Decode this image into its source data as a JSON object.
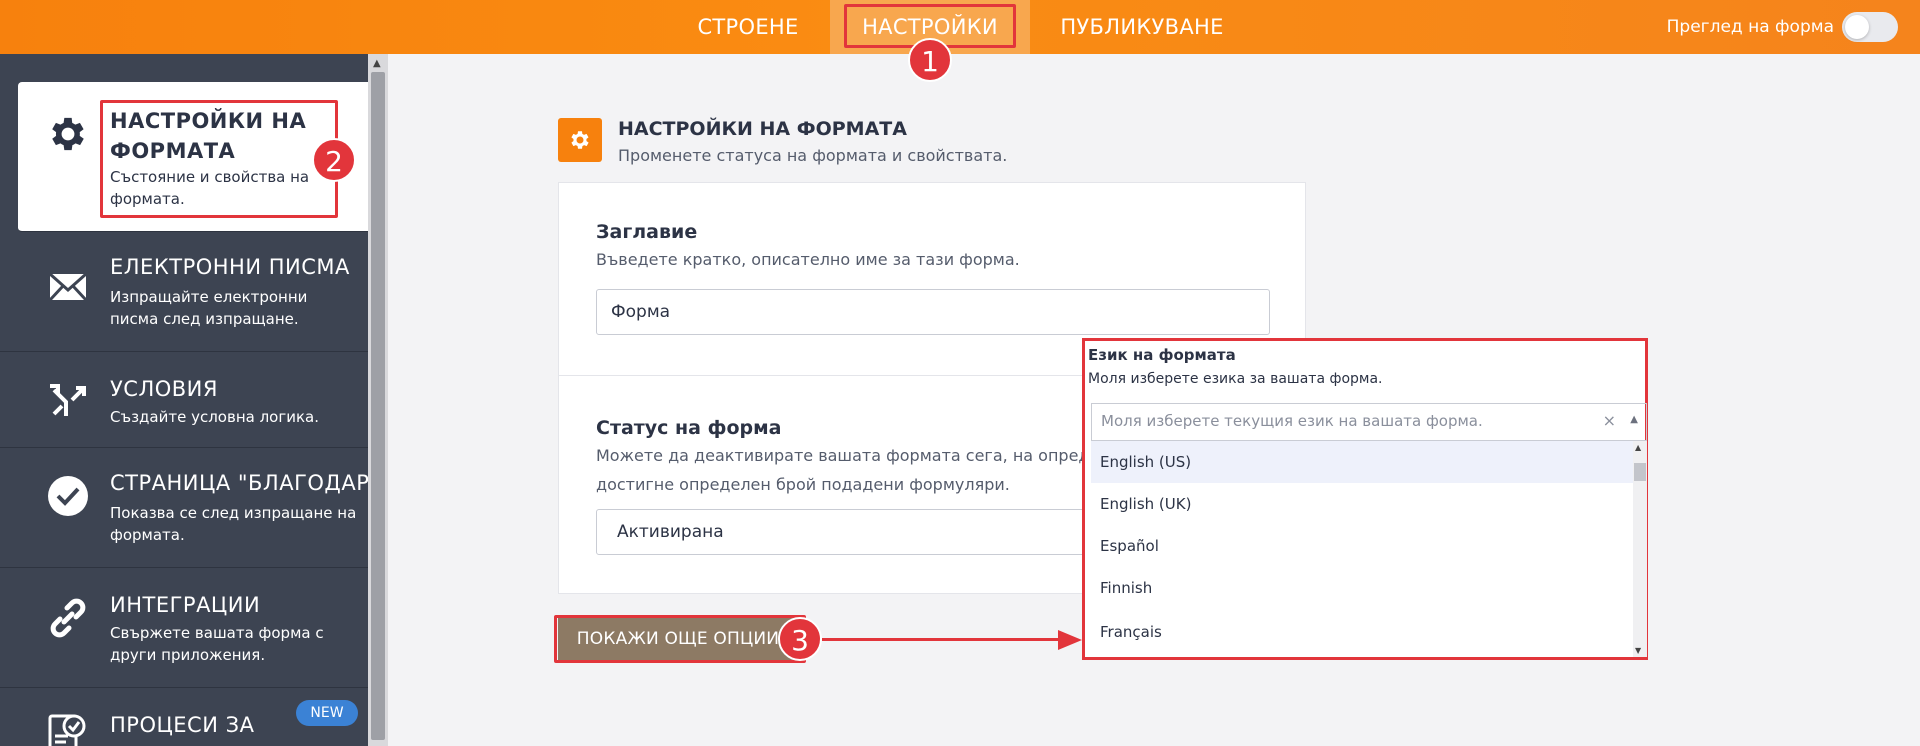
{
  "topbar": {
    "tabs": [
      {
        "label": "СТРОЕНЕ"
      },
      {
        "label": "НАСТРОЙКИ"
      },
      {
        "label": "ПУБЛИКУВАНЕ"
      }
    ],
    "preview_label": "Преглед на форма"
  },
  "sidebar": {
    "items": [
      {
        "title": "НАСТРОЙКИ НА ФОРМАТА",
        "desc": "Състояние и свойства на формата."
      },
      {
        "title": "ЕЛЕКТРОННИ ПИСМА",
        "desc": "Изпращайте електронни писма след изпращане."
      },
      {
        "title": "УСЛОВИЯ",
        "desc": "Създайте условна логика."
      },
      {
        "title": "СТРАНИЦА \"БЛАГОДАРЯ\"",
        "desc": "Показва се след изпращане на формата."
      },
      {
        "title": "ИНТЕГРАЦИИ",
        "desc": "Свържете вашата форма с други приложения."
      },
      {
        "title": "ПРОЦЕСИ ЗА",
        "badge": "NEW"
      }
    ]
  },
  "main": {
    "section_title": "НАСТРОЙКИ НА ФОРМАТА",
    "section_subtitle": "Променете статуса на формата и свойствата.",
    "title_field": {
      "label": "Заглавие",
      "desc": "Въведете кратко, описателно име за тази форма.",
      "value": "Форма"
    },
    "status_field": {
      "label": "Статус на форма",
      "desc_line1": "Можете да деактивирате вашата формата сега, на определе",
      "desc_line2": "достигне определен брой подадени формуляри.",
      "value": "Активирана"
    },
    "more_options_button": "ПОКАЖИ ОЩЕ ОПЦИИ"
  },
  "language_popup": {
    "title": "Език на формата",
    "subtitle": "Моля изберете езика за вашата форма.",
    "search_placeholder": "Моля изберете текущия език на вашата форма.",
    "clear_symbol": "×",
    "options": [
      "English (US)",
      "English (UK)",
      "Español",
      "Finnish",
      "Français"
    ]
  },
  "annotations": {
    "steps": [
      "1",
      "2",
      "3"
    ]
  },
  "colors": {
    "accent": "#f7810d",
    "sidebar_bg": "#3d4452",
    "annotation_red": "#e2353b",
    "more_button_bg": "#8d7a64"
  }
}
